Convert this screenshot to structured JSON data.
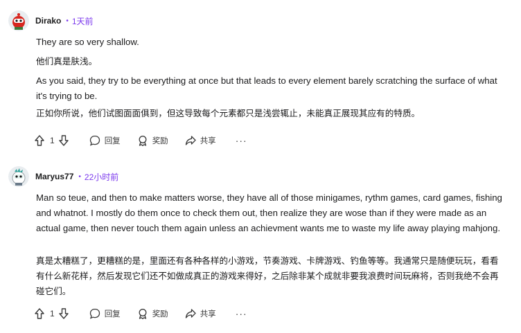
{
  "comments": [
    {
      "username": "Dirako",
      "time": "1天前",
      "paragraphs": [
        "They are so very shallow.",
        "他们真是肤浅。",
        "As you said, they try to be everything at once but that leads to every element barely scratching the surface of what it's trying to be.",
        "正如你所说，他们试图面面俱到，但这导致每个元素都只是浅尝辄止，未能真正展现其应有的特质。"
      ],
      "actions": {
        "vote_count": "1",
        "reply": "回复",
        "award": "奖励",
        "share": "共享",
        "more": "···"
      }
    },
    {
      "username": "Maryus77",
      "time": "22小时前",
      "paragraphs": [
        "Man so teue, and then to make matters worse, they have all of those minigames, rythm games, card games, fishing and whatnot. I mostly do them once to check them out, then realize they are wose than if they were made as an actual game, then never touch them again unless an achievment wants me to waste my life away playing mahjong.",
        "真是太糟糕了，更糟糕的是，里面还有各种各样的小游戏，节奏游戏、卡牌游戏、钓鱼等等。我通常只是随便玩玩，看看有什么新花样，然后发现它们还不如做成真正的游戏来得好，之后除非某个成就非要我浪费时间玩麻将，否则我绝不会再碰它们。"
      ],
      "actions": {
        "vote_count": "1",
        "reply": "回复",
        "award": "奖励",
        "share": "共享",
        "more": "···"
      }
    }
  ],
  "icons": {
    "avatar_1": "red-robot-avatar",
    "avatar_2": "teal-robot-avatar",
    "upvote": "arrow-up-icon",
    "downvote": "arrow-down-icon",
    "reply": "speech-bubble-icon",
    "award": "award-icon",
    "share": "share-arrow-icon"
  },
  "colors": {
    "accent": "#7c3aed",
    "text": "#1a1a1b"
  }
}
